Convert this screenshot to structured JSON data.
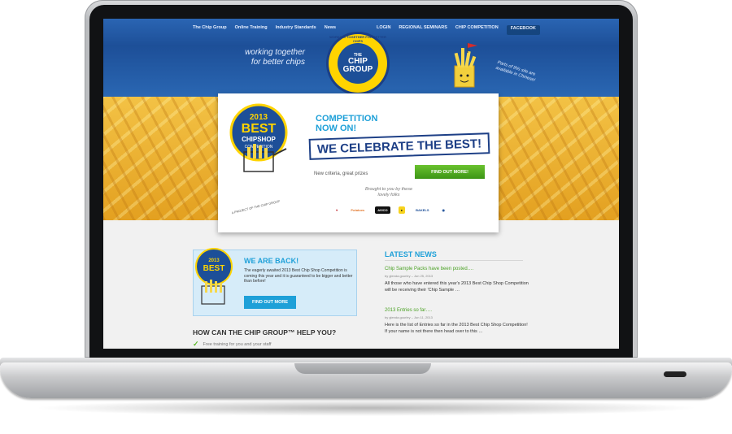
{
  "nav": {
    "left": [
      "The Chip Group",
      "Online Training",
      "Industry Standards",
      "News"
    ],
    "right": [
      "LOGIN",
      "REGIONAL SEMINARS",
      "CHIP COMPETITION"
    ],
    "facebook": "FACEBOOK"
  },
  "header": {
    "tagline_1": "working together",
    "tagline_2": "for better chips",
    "sidenote": "Parts of this site are available in Chinese!",
    "logo_the": "THE",
    "logo_chip": "CHIP",
    "logo_group": "GROUP",
    "logo_ring": "WORKING TOGETHER FOR BETTER CHIPS",
    "tm": "™"
  },
  "hero": {
    "badge_year": "2013",
    "badge_best": "BEST",
    "badge_chipshop": "CHIPSHOP",
    "badge_competition": "COMPETITION",
    "project": "A PROJECT OF THE CHIP GROUP",
    "competition": "COMPETITION",
    "now_on": "NOW ON!",
    "celebrate": "WE CELEBRATE THE BEST!",
    "criteria": "New criteria, great prizes",
    "find_btn": "FIND OUT MORE!",
    "brought": "Brought to you by these lovely folks",
    "sponsors": [
      "Potatoes",
      "AVICO",
      "BAKELS"
    ]
  },
  "promo": {
    "title": "WE ARE BACK!",
    "text": "The eagerly awaited 2013 Best Chip Shop Competition is coming this year and it is guaranteed to be bigger and better than before!",
    "button": "FIND OUT MORE"
  },
  "help": {
    "title": "HOW CAN THE CHIP GROUP™ HELP YOU?",
    "item": "Free training for you and your staff"
  },
  "news": {
    "title": "LATEST NEWS",
    "articles": [
      {
        "title": "Chip Sample Packs have been posted….",
        "meta": "by glenda.gourley – Jun 25, 2013",
        "excerpt": "All those who have entered this year's 2013 Best Chip Shop Competition will be receiving their 'Chip Sample …"
      },
      {
        "title": "2013 Entries so far….",
        "meta": "by glenda.gourley – Jun 11, 2013",
        "excerpt": "Here is the list of Entries so far in the 2013 Best Chip Shop Competition!  If your name is not there then head over to this …"
      }
    ]
  },
  "colors": {
    "brand_blue": "#1d4f98",
    "accent_cyan": "#1ea0d8",
    "cta_green": "#4aa124",
    "logo_yellow": "#ffd400"
  }
}
